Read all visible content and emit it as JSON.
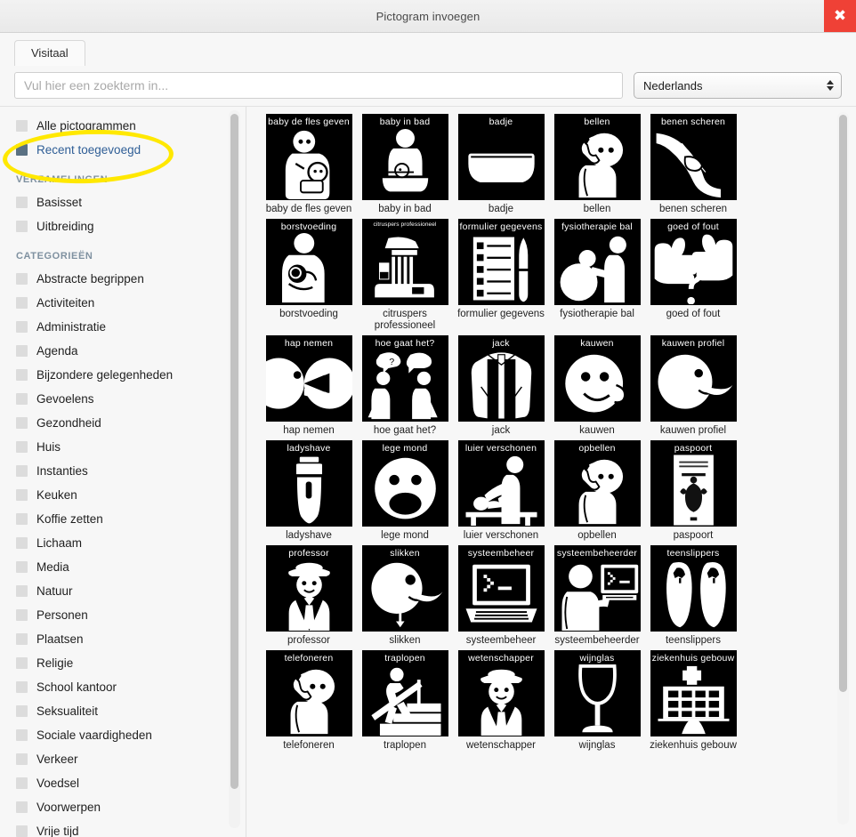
{
  "window": {
    "title": "Pictogram invoegen",
    "close_label": "✖",
    "close_icon": "close-icon"
  },
  "tabs": [
    {
      "label": "Visitaal",
      "active": true
    }
  ],
  "search": {
    "placeholder": "Vul hier een zoekterm in...",
    "value": ""
  },
  "language_select": {
    "selected": "Nederlands",
    "options": [
      "Nederlands"
    ],
    "icon": "stepper-arrows-icon"
  },
  "sidebar": {
    "top_items": [
      {
        "label": "Alle pictogrammen",
        "selected": false
      },
      {
        "label": "Recent toegevoegd",
        "selected": true
      }
    ],
    "groups": [
      {
        "heading": "VERZAMELINGEN",
        "items": [
          {
            "label": "Basisset",
            "selected": false
          },
          {
            "label": "Uitbreiding",
            "selected": false
          }
        ]
      },
      {
        "heading": "CATEGORIEËN",
        "items": [
          {
            "label": "Abstracte begrippen",
            "selected": false
          },
          {
            "label": "Activiteiten",
            "selected": false
          },
          {
            "label": "Administratie",
            "selected": false
          },
          {
            "label": "Agenda",
            "selected": false
          },
          {
            "label": "Bijzondere gelegenheden",
            "selected": false
          },
          {
            "label": "Gevoelens",
            "selected": false
          },
          {
            "label": "Gezondheid",
            "selected": false
          },
          {
            "label": "Huis",
            "selected": false
          },
          {
            "label": "Instanties",
            "selected": false
          },
          {
            "label": "Keuken",
            "selected": false
          },
          {
            "label": "Koffie zetten",
            "selected": false
          },
          {
            "label": "Lichaam",
            "selected": false
          },
          {
            "label": "Media",
            "selected": false
          },
          {
            "label": "Natuur",
            "selected": false
          },
          {
            "label": "Personen",
            "selected": false
          },
          {
            "label": "Plaatsen",
            "selected": false
          },
          {
            "label": "Religie",
            "selected": false
          },
          {
            "label": "School kantoor",
            "selected": false
          },
          {
            "label": "Seksualiteit",
            "selected": false
          },
          {
            "label": "Sociale vaardigheden",
            "selected": false
          },
          {
            "label": "Verkeer",
            "selected": false
          },
          {
            "label": "Voedsel",
            "selected": false
          },
          {
            "label": "Voorwerpen",
            "selected": false
          },
          {
            "label": "Vrije tijd",
            "selected": false
          }
        ]
      }
    ]
  },
  "pictograms": [
    {
      "caption": "baby de fles geven",
      "tile_word": "baby de fles geven",
      "glyph": "baby-bottle"
    },
    {
      "caption": "baby in bad",
      "tile_word": "baby in bad",
      "glyph": "baby-bath"
    },
    {
      "caption": "badje",
      "tile_word": "badje",
      "glyph": "bathtub"
    },
    {
      "caption": "bellen",
      "tile_word": "bellen",
      "glyph": "phone-head"
    },
    {
      "caption": "benen scheren",
      "tile_word": "benen scheren",
      "glyph": "leg-shave"
    },
    {
      "caption": "borstvoeding",
      "tile_word": "borstvoeding",
      "glyph": "breastfeeding"
    },
    {
      "caption": "citruspers professioneel",
      "tile_word": "citruspers professioneel",
      "glyph": "citrus-press",
      "tile_word_small": true
    },
    {
      "caption": "formulier gegevens",
      "tile_word": "formulier gegevens",
      "glyph": "form-pen"
    },
    {
      "caption": "fysiotherapie bal",
      "tile_word": "fysiotherapie bal",
      "glyph": "physio-ball"
    },
    {
      "caption": "goed of fout",
      "tile_word": "goed of fout",
      "glyph": "thumbs-question"
    },
    {
      "caption": "hap nemen",
      "tile_word": "hap nemen",
      "glyph": "bite"
    },
    {
      "caption": "hoe gaat het?",
      "tile_word": "hoe gaat het?",
      "glyph": "two-people-talk"
    },
    {
      "caption": "jack",
      "tile_word": "jack",
      "glyph": "jacket"
    },
    {
      "caption": "kauwen",
      "tile_word": "kauwen",
      "glyph": "chew-face"
    },
    {
      "caption": "kauwen profiel",
      "tile_word": "kauwen profiel",
      "glyph": "chew-profile"
    },
    {
      "caption": "ladyshave",
      "tile_word": "ladyshave",
      "glyph": "shaver"
    },
    {
      "caption": "lege mond",
      "tile_word": "lege mond",
      "glyph": "open-mouth-face"
    },
    {
      "caption": "luier verschonen",
      "tile_word": "luier verschonen",
      "glyph": "diaper-change"
    },
    {
      "caption": "opbellen",
      "tile_word": "opbellen",
      "glyph": "phone-head"
    },
    {
      "caption": "paspoort",
      "tile_word": "paspoort",
      "glyph": "passport"
    },
    {
      "caption": "professor",
      "tile_word": "professor",
      "glyph": "professor"
    },
    {
      "caption": "slikken",
      "tile_word": "slikken",
      "glyph": "swallow"
    },
    {
      "caption": "systeembeheer",
      "tile_word": "systeembeheer",
      "glyph": "laptop-terminal"
    },
    {
      "caption": "systeembeheerder",
      "tile_word": "systeembeheerder",
      "glyph": "sysadmin"
    },
    {
      "caption": "teenslippers",
      "tile_word": "teenslippers",
      "glyph": "flipflops"
    },
    {
      "caption": "telefoneren",
      "tile_word": "telefoneren",
      "glyph": "phone-head"
    },
    {
      "caption": "traplopen",
      "tile_word": "traplopen",
      "glyph": "stairs"
    },
    {
      "caption": "wetenschapper",
      "tile_word": "wetenschapper",
      "glyph": "scientist"
    },
    {
      "caption": "wijnglas",
      "tile_word": "wijnglas",
      "glyph": "wine-glass"
    },
    {
      "caption": "ziekenhuis gebouw",
      "tile_word": "ziekenhuis gebouw",
      "glyph": "hospital"
    }
  ],
  "annotation": {
    "shape": "ellipse-highlight",
    "color": "#ffe800",
    "targets": "Recent toegevoegd"
  },
  "colors": {
    "close_red": "#ef4136",
    "selected_blue": "#2f5e96",
    "checkbox_selected": "#5a7183",
    "heading_gray": "#7f91a0",
    "tile_black": "#000000"
  }
}
